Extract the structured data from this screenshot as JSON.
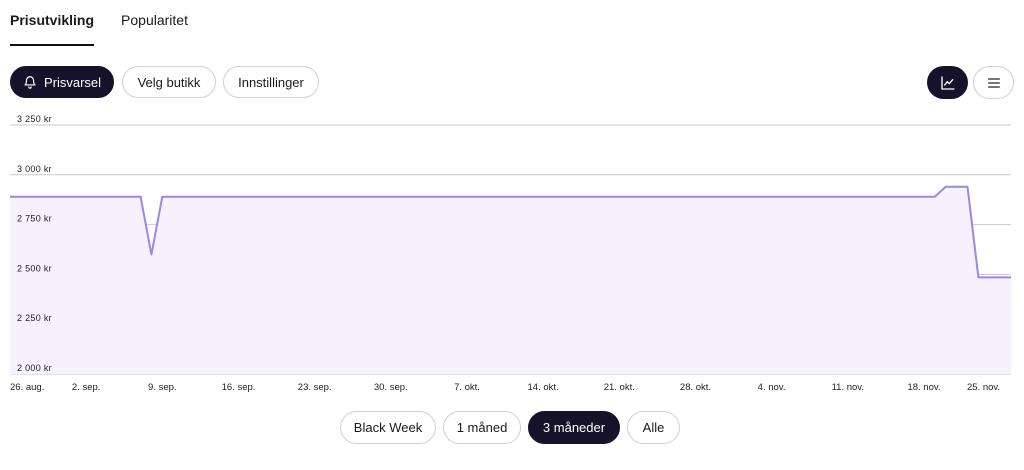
{
  "tabs": [
    {
      "label": "Prisutvikling",
      "active": true
    },
    {
      "label": "Popularitet",
      "active": false
    }
  ],
  "toolbar": {
    "price_alert_label": "Prisvarsel",
    "price_alert_icon": "bell-icon",
    "choose_store_label": "Velg butikk",
    "settings_label": "Innstillinger",
    "chart_view_icon": "line-chart-icon",
    "list_view_icon": "menu-icon"
  },
  "chart_data": {
    "type": "area",
    "x": [
      "2024-08-26",
      "2024-09-07",
      "2024-09-08",
      "2024-09-09",
      "2024-11-19",
      "2024-11-20",
      "2024-11-22",
      "2024-11-23",
      "2024-11-26"
    ],
    "y": [
      2890,
      2890,
      2600,
      2890,
      2890,
      2940,
      2940,
      2485,
      2485
    ],
    "ylim": [
      2000,
      3250
    ],
    "yticks": [
      "3 250 kr",
      "3 000 kr",
      "2 750 kr",
      "2 500 kr",
      "2 250 kr",
      "2 000 kr"
    ],
    "xticks": [
      "26. aug.",
      "2. sep.",
      "9. sep.",
      "16. sep.",
      "23. sep.",
      "30. sep.",
      "7. okt.",
      "14. okt.",
      "21. okt.",
      "28. okt.",
      "4. nov.",
      "11. nov.",
      "18. nov.",
      "25. nov."
    ],
    "line_color": "#9b87e6",
    "fill_color": "#f5f2fd",
    "grid": true
  },
  "ranges": [
    {
      "label": "Black Week",
      "active": false
    },
    {
      "label": "1 måned",
      "active": false
    },
    {
      "label": "3 måneder",
      "active": true
    },
    {
      "label": "Alle",
      "active": false
    }
  ]
}
